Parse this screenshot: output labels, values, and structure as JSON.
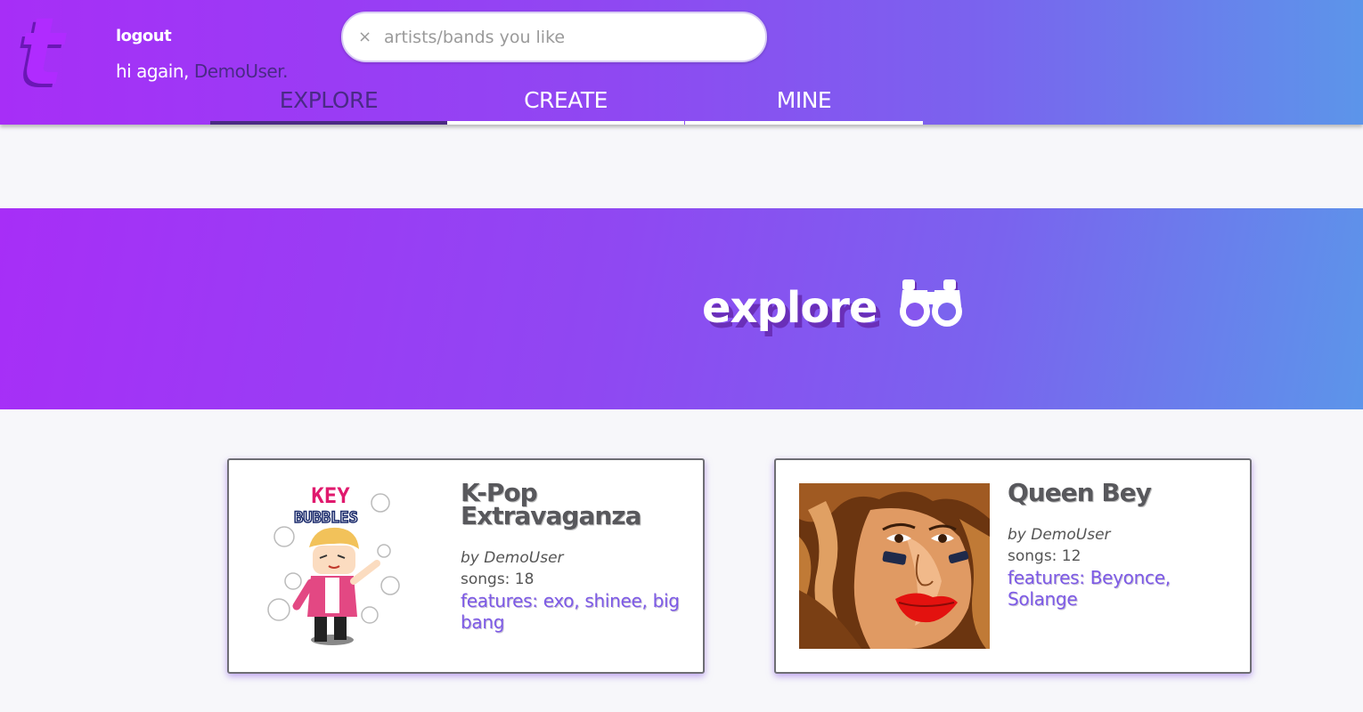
{
  "header": {
    "logo_letter": "t",
    "logout_label": "logout",
    "greeting_prefix": "hi again,",
    "username": "DemoUser.",
    "search": {
      "clear_glyph": "×",
      "placeholder": "artists/bands you like",
      "value": ""
    },
    "nav": {
      "tabs": [
        {
          "label": "EXPLORE",
          "active": true
        },
        {
          "label": "CREATE",
          "active": false
        },
        {
          "label": "MINE",
          "active": false
        }
      ]
    },
    "colors": {
      "gradient_start": "#a72ef7",
      "gradient_end": "#5c95ea",
      "active_tab_text": "#4a2a86"
    }
  },
  "banner": {
    "title": "explore",
    "icon": "binoculars-icon"
  },
  "playlists": [
    {
      "title": "K-Pop Extravaganza",
      "author": "by DemoUser",
      "songs": "songs: 18",
      "features": "features: exo, shinee, big bang",
      "art_text_top": "KEY",
      "art_text_bottom": "BUBBLES"
    },
    {
      "title": "Queen Bey",
      "author": "by DemoUser",
      "songs": "songs: 12",
      "features": "features: Beyonce, Solange",
      "art_text_top": "",
      "art_text_bottom": ""
    }
  ],
  "accent_color": "#7d5ae6"
}
